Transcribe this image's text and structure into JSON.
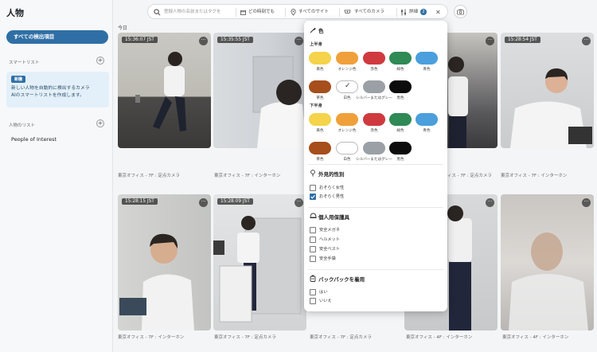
{
  "sidebar": {
    "title": "人物",
    "primary_button": "すべての検出項目",
    "smart_list_label": "スマートリスト",
    "new_badge": "新機",
    "info_text_1": "新しい人物を自動的に検出するカメラ",
    "info_text_2": "AIのスマートリストを作成します。",
    "people_list_label": "人物のリスト",
    "people_item": "People of Interest"
  },
  "search": {
    "placeholder": "登録人物の名前またはタグを",
    "time_filter": "どの時刻でも",
    "site_filter": "すべてのサイト",
    "camera_filter": "すべてのカメラ",
    "detail_filter": "詳細",
    "detail_count": "2"
  },
  "today_label": "今日",
  "cards": [
    {
      "time": "15:36:07 JST",
      "caption": "東京オフィス - 7F : 定点カメラ"
    },
    {
      "time": "15:35:55 JST",
      "caption": "東京オフィス - 7F : インターホン"
    },
    {
      "time": "",
      "caption": ""
    },
    {
      "time": "",
      "caption": "東京オフィス - 7F : 定点カメラ"
    },
    {
      "time": "15:28:54 JST",
      "caption": "東京オフィス - 7F : インターホン"
    },
    {
      "time": "15:28:15 JST",
      "caption": "東京オフィス - 7F : インターホン"
    },
    {
      "time": "15:28:09 JST",
      "caption": "東京オフィス - 7F : 定点カメラ"
    },
    {
      "time": "",
      "caption": "東京オフィス - 7F : 定点カメラ"
    },
    {
      "time": "",
      "caption": "東京オフィス - 4F : インターホン"
    },
    {
      "time": "",
      "caption": "東京オフィス - 4F : インターホン"
    }
  ],
  "panel": {
    "color_title": "色",
    "upper_label": "上半身",
    "lower_label": "下半身",
    "colors": [
      {
        "label": "黄色",
        "hex": "#f5d34a"
      },
      {
        "label": "オレンジ色",
        "hex": "#f0a03a"
      },
      {
        "label": "赤色",
        "hex": "#cf3a3f"
      },
      {
        "label": "緑色",
        "hex": "#2f8a55"
      },
      {
        "label": "青色",
        "hex": "#4a9fdc"
      },
      {
        "label": "茶色",
        "hex": "#a64e1c"
      },
      {
        "label": "白色",
        "hex": "#ffffff"
      },
      {
        "label": "シルバーまたはグレー",
        "hex": "#9aa0a6"
      },
      {
        "label": "黒色",
        "hex": "#0c0c0c"
      }
    ],
    "gender_title": "外見的性別",
    "gender_options": [
      {
        "label": "おそらく女性",
        "checked": false
      },
      {
        "label": "おそらく男性",
        "checked": true
      }
    ],
    "ppe_title": "個人用保護具",
    "ppe_options": [
      {
        "label": "安全メガネ",
        "checked": false
      },
      {
        "label": "ヘルメット",
        "checked": false
      },
      {
        "label": "安全ベスト",
        "checked": false
      },
      {
        "label": "安全手袋",
        "checked": false
      }
    ],
    "backpack_title": "バックパックを着用",
    "backpack_options": [
      {
        "label": "はい",
        "checked": false
      },
      {
        "label": "いいえ",
        "checked": false
      }
    ]
  }
}
